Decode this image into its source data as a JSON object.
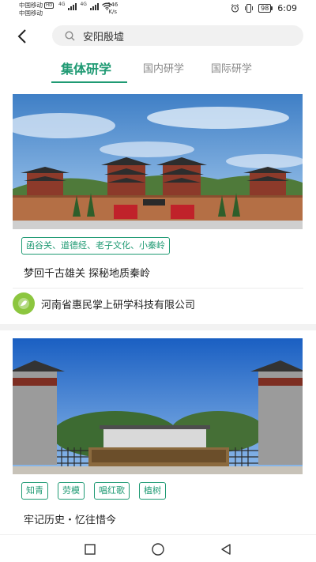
{
  "status_bar": {
    "carrier_1": "中国移动",
    "carrier_2": "中国移动",
    "hd_badge": "HD",
    "network": "4G",
    "speed_value": "146",
    "speed_unit": "K/s",
    "battery": "98",
    "time": "6:09",
    "icons": [
      "alarm-icon",
      "vibrate-icon",
      "wifi-icon",
      "signal-icon",
      "battery-icon"
    ]
  },
  "header": {
    "back_icon": "chevron-left-icon",
    "search_icon": "search-icon",
    "search_value": "安阳殷墟"
  },
  "tabs": [
    {
      "label": "集体研学",
      "active": true
    },
    {
      "label": "国内研学",
      "active": false
    },
    {
      "label": "国际研学",
      "active": false
    }
  ],
  "cards": [
    {
      "tags": [
        "函谷关、道德经、老子文化、小秦岭"
      ],
      "title": "梦回千古雄关 探秘地质秦岭",
      "organization": "河南省惠民掌上研学科技有限公司"
    },
    {
      "tags": [
        "知青",
        "劳模",
        "唱红歌",
        "植树"
      ],
      "title": "牢记历史・忆往惜今"
    }
  ],
  "nav_bar": {
    "buttons": [
      "recent-apps-icon",
      "home-icon",
      "back-triangle-icon"
    ]
  },
  "colors": {
    "accent": "#1f9a73",
    "background": "#f2f2f2",
    "card": "#ffffff"
  }
}
